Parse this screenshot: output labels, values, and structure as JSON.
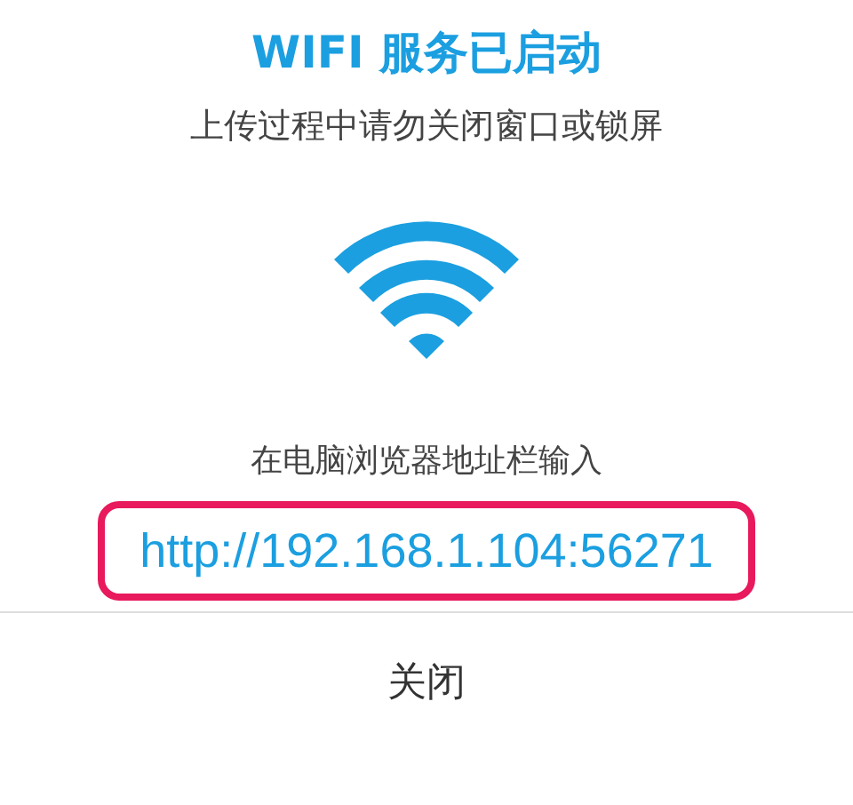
{
  "dialog": {
    "title": "WIFI 服务已启动",
    "message": "上传过程中请勿关闭窗口或锁屏",
    "instruction": "在电脑浏览器地址栏输入",
    "url": "http://192.168.1.104:56271",
    "url_highlighted": true,
    "buttons": [
      "关闭"
    ]
  }
}
